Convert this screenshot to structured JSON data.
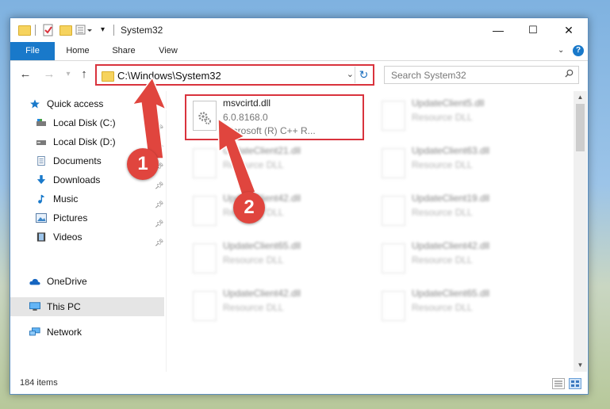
{
  "window": {
    "title": "System32",
    "controls": {
      "minimize": "—",
      "maximize": "☐",
      "close": "✕"
    }
  },
  "ribbon": {
    "tabs": [
      {
        "label": "File"
      },
      {
        "label": "Home"
      },
      {
        "label": "Share"
      },
      {
        "label": "View"
      }
    ],
    "help": "?"
  },
  "address": {
    "path": "C:\\Windows\\System32",
    "search_placeholder": "Search System32"
  },
  "sidebar": {
    "items": [
      {
        "label": "Quick access",
        "icon": "star-icon",
        "pinned": false
      },
      {
        "label": "Local Disk (C:)",
        "icon": "drive-icon",
        "pinned": true
      },
      {
        "label": "Local Disk (D:)",
        "icon": "drive-icon",
        "pinned": true
      },
      {
        "label": "Documents",
        "icon": "documents-icon",
        "pinned": true
      },
      {
        "label": "Downloads",
        "icon": "download-icon",
        "pinned": true
      },
      {
        "label": "Music",
        "icon": "music-icon",
        "pinned": true
      },
      {
        "label": "Pictures",
        "icon": "pictures-icon",
        "pinned": true
      },
      {
        "label": "Videos",
        "icon": "videos-icon",
        "pinned": true
      },
      {
        "label": "OneDrive",
        "icon": "cloud-icon",
        "pinned": false
      },
      {
        "label": "This PC",
        "icon": "computer-icon",
        "pinned": false,
        "selected": true
      },
      {
        "label": "Network",
        "icon": "network-icon",
        "pinned": false
      }
    ]
  },
  "files": [
    {
      "name": "msvcirtd.dll",
      "line2": "6.0.8168.0",
      "line3": "Microsoft (R) C++ R...",
      "highlighted": true
    },
    {
      "name": "UpdateClient5.dll",
      "line2": "Resource DLL"
    },
    {
      "name": "UpdateClient21.dll",
      "line2": "Resource DLL"
    },
    {
      "name": "UpdateClient63.dll",
      "line2": "Resource DLL"
    },
    {
      "name": "UpdateClient42.dll",
      "line2": "Resource DLL"
    },
    {
      "name": "UpdateClient19.dll",
      "line2": "Resource DLL"
    },
    {
      "name": "UpdateClient65.dll",
      "line2": "Resource DLL"
    },
    {
      "name": "UpdateClient42.dll",
      "line2": "Resource DLL"
    },
    {
      "name": "UpdateClient42.dll",
      "line2": "Resource DLL"
    },
    {
      "name": "UpdateClient65.dll",
      "line2": "Resource DLL"
    }
  ],
  "status": {
    "item_count": "184 items"
  },
  "annotations": [
    {
      "number": "1"
    },
    {
      "number": "2"
    }
  ],
  "colors": {
    "accent": "#1979ca",
    "highlight": "#d9333d",
    "badge": "#e0453e"
  }
}
